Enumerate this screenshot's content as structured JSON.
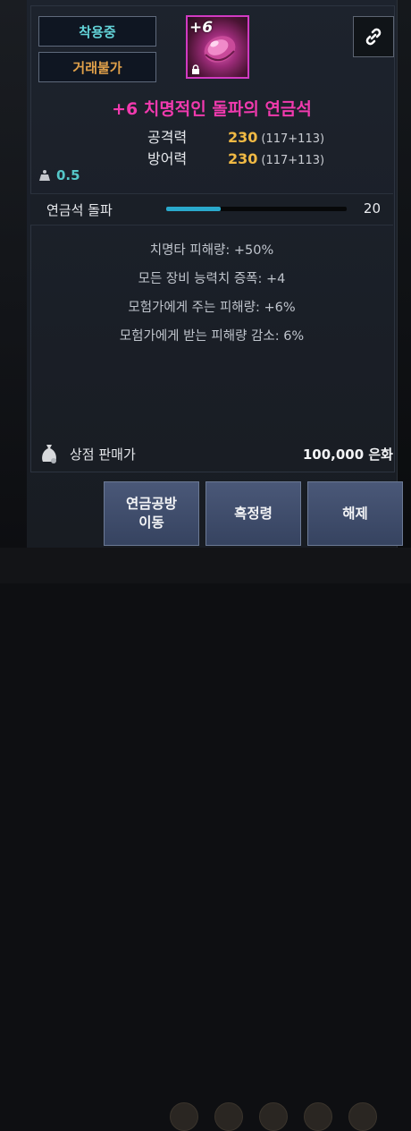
{
  "badges": {
    "equipped": "착용중",
    "trade": "거래불가"
  },
  "item": {
    "enhance": "+6",
    "name": "+6 치명적인 돌파의 연금석",
    "icon": "alchemy-stone-gem-icon",
    "rarity_color": "#f13aae"
  },
  "stats": [
    {
      "label": "공격력",
      "value": "230",
      "detail": "(117+113)"
    },
    {
      "label": "방어력",
      "value": "230",
      "detail": "(117+113)"
    }
  ],
  "weight": {
    "icon": "weight-icon",
    "value": "0.5"
  },
  "progress": {
    "label": "연금석 돌파",
    "value": "20",
    "fraction": 0.3
  },
  "effects": [
    "치명타 피해량: +50%",
    "모든 장비 능력치 증폭: +4",
    "모험가에게 주는 피해량: +6%",
    "모험가에게 받는 피해량 감소: 6%"
  ],
  "sell": {
    "icon": "money-bag-icon",
    "label": "상점 판매가",
    "price": "100,000 은화"
  },
  "buttons": {
    "workshop_line1": "연금공방",
    "workshop_line2": "이동",
    "blackstone": "흑정령",
    "unequip": "해제"
  }
}
